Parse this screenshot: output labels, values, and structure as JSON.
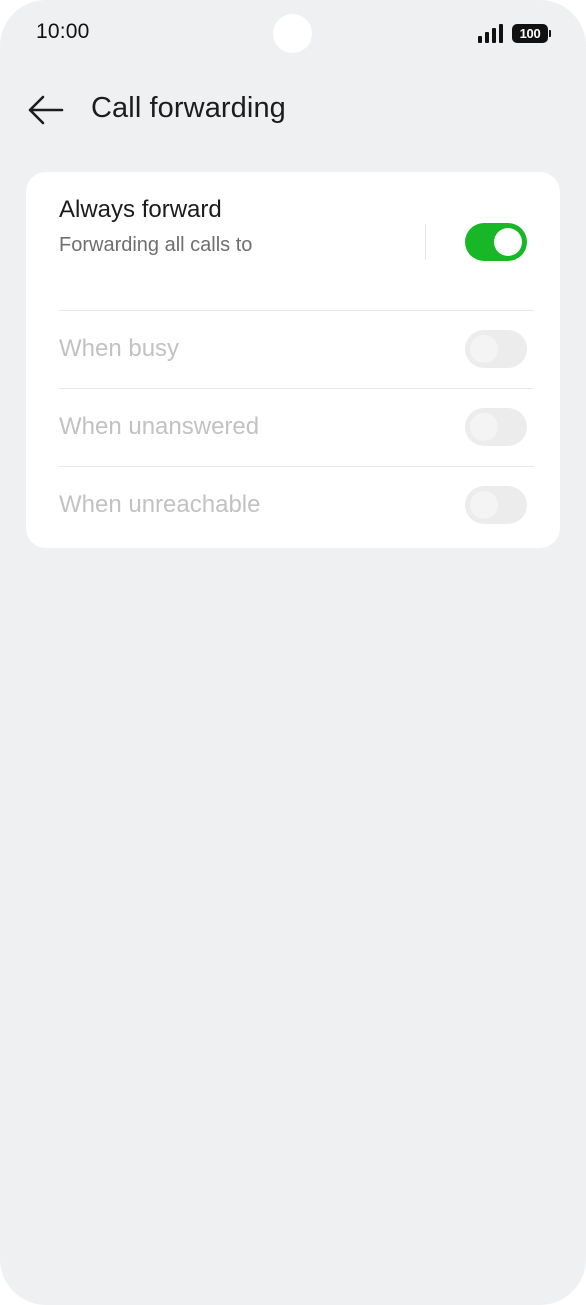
{
  "status_bar": {
    "time": "10:00",
    "signal_icon": "signal-bars-icon",
    "battery_level": "100"
  },
  "header": {
    "back_icon": "arrow-left-icon",
    "title": "Call forwarding"
  },
  "always_forward": {
    "title": "Always forward",
    "subtitle": "Forwarding all calls to",
    "enabled": true
  },
  "options": [
    {
      "label": "When busy",
      "enabled": false,
      "disabled": true
    },
    {
      "label": "When unanswered",
      "enabled": false,
      "disabled": true
    },
    {
      "label": "When unreachable",
      "enabled": false,
      "disabled": true
    }
  ],
  "colors": {
    "background": "#eff0f2",
    "card": "#ffffff",
    "toggle_on": "#17b728",
    "toggle_off": "#ececec",
    "disabled_text": "#c2c2c2"
  }
}
